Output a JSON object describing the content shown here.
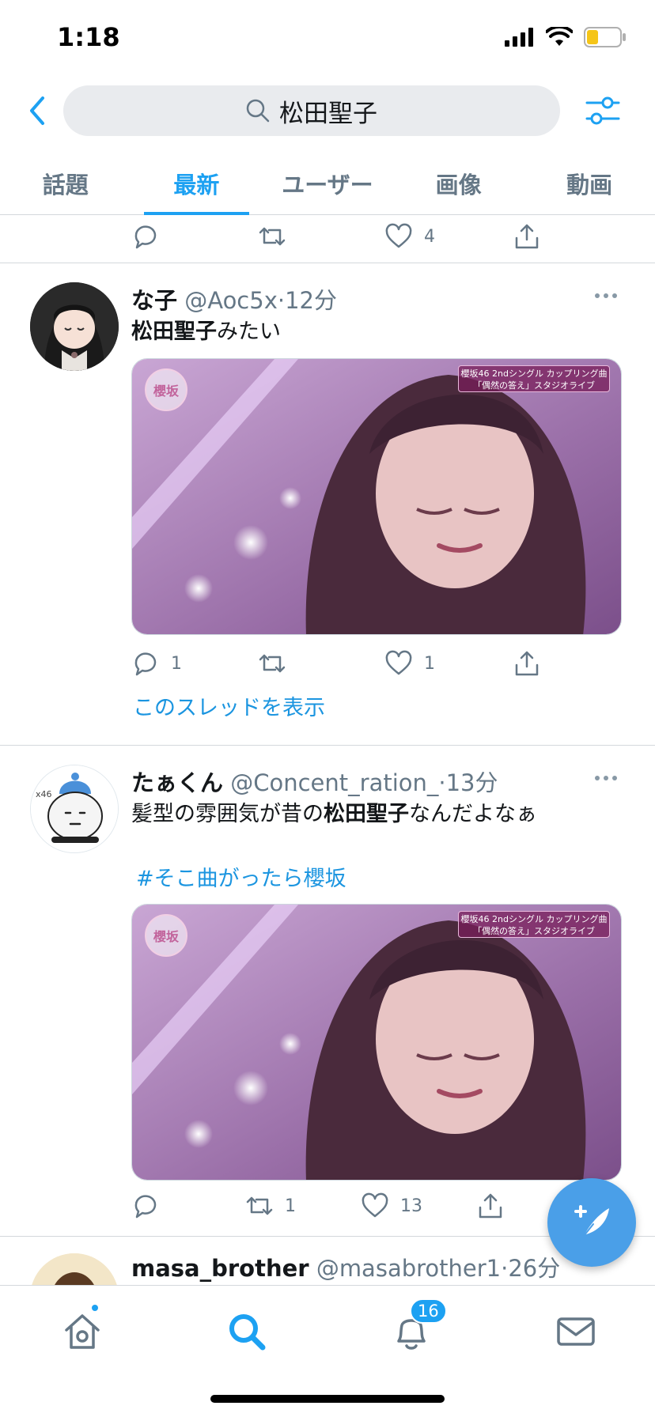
{
  "status_bar": {
    "time": "1:18"
  },
  "search": {
    "query": "松田聖子"
  },
  "tabs": [
    {
      "label": "話題",
      "active": false
    },
    {
      "label": "最新",
      "active": true
    },
    {
      "label": "ユーザー",
      "active": false
    },
    {
      "label": "画像",
      "active": false
    },
    {
      "label": "動画",
      "active": false
    }
  ],
  "prev_tweet_actions": {
    "reply_count": "",
    "retweet_count": "",
    "like_count": "4"
  },
  "tweets": [
    {
      "name": "な子",
      "handle": "@Aoc5x",
      "time": "12分",
      "text_bold": "松田聖子",
      "text_rest": "みたい",
      "media": {
        "badge_line1": "櫻坂46 2ndシングル カップリング曲",
        "badge_line2": "「偶然の答え」スタジオライブ",
        "logo": "櫻坂"
      },
      "reply_count": "1",
      "retweet_count": "",
      "like_count": "1",
      "thread_link": "このスレッドを表示"
    },
    {
      "name": "たぁくん",
      "handle": "@Concent_ration_",
      "time": "13分",
      "text_pre": "髪型の雰囲気が昔の",
      "text_bold": "松田聖子",
      "text_rest": "なんだよなぁ",
      "hashtag": "#そこ曲がったら櫻坂",
      "media": {
        "badge_line1": "櫻坂46 2ndシングル カップリング曲",
        "badge_line2": "「偶然の答え」スタジオライブ",
        "logo": "櫻坂"
      },
      "reply_count": "",
      "retweet_count": "1",
      "like_count": "13"
    },
    {
      "name": "masa_brother",
      "handle": "@masabrother1",
      "time": "26分"
    }
  ],
  "bottom_nav": {
    "notification_count": "16"
  },
  "colors": {
    "accent": "#1da1f2",
    "text": "#14171a",
    "secondary": "#657786"
  }
}
